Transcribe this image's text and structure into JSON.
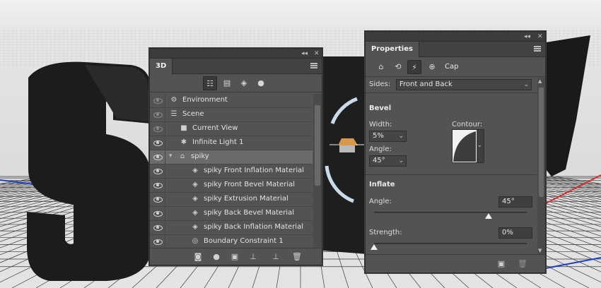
{
  "panel_3d": {
    "tab_label": "3D",
    "collapse_glyph": "◂◂",
    "close_glyph": "✕",
    "filter_icons": [
      "scene-filter-icon",
      "mesh-filter-icon",
      "material-filter-icon",
      "light-filter-icon"
    ],
    "rows": [
      {
        "label": "Environment",
        "icon": "⚙",
        "icon_name": "environment-icon",
        "indent": 1,
        "eye": "dim"
      },
      {
        "label": "Scene",
        "icon": "☰",
        "icon_name": "scene-icon",
        "indent": 1,
        "eye": "dim"
      },
      {
        "label": "Current View",
        "icon": "■",
        "icon_name": "camera-icon",
        "indent": 2,
        "eye": "dim"
      },
      {
        "label": "Infinite Light 1",
        "icon": "✱",
        "icon_name": "light-icon",
        "indent": 2,
        "eye": "on"
      },
      {
        "label": "spiky",
        "icon": "⌂",
        "icon_name": "mesh-icon",
        "indent": 1,
        "eye": "on",
        "selected": true,
        "twist": "▾"
      },
      {
        "label": "spiky Front Inflation Material",
        "icon": "◈",
        "icon_name": "material-icon",
        "indent": 3,
        "eye": "on"
      },
      {
        "label": "spiky Front Bevel Material",
        "icon": "◈",
        "icon_name": "material-icon",
        "indent": 3,
        "eye": "on"
      },
      {
        "label": "spiky Extrusion Material",
        "icon": "◈",
        "icon_name": "material-icon",
        "indent": 3,
        "eye": "on"
      },
      {
        "label": "spiky Back Bevel Material",
        "icon": "◈",
        "icon_name": "material-icon",
        "indent": 3,
        "eye": "on"
      },
      {
        "label": "spiky Back Inflation Material",
        "icon": "◈",
        "icon_name": "material-icon",
        "indent": 3,
        "eye": "on"
      },
      {
        "label": "Boundary Constraint 1",
        "icon": "◎",
        "icon_name": "constraint-icon",
        "indent": 3,
        "eye": "on"
      }
    ],
    "bottom_icons": [
      "light-add-icon",
      "new-light-icon",
      "render-icon",
      "ground-icon",
      "drop-to-plane-icon",
      "trash-icon"
    ]
  },
  "properties": {
    "tab_label": "Properties",
    "collapse_glyph": "◂◂",
    "close_glyph": "✕",
    "mode_label": "Cap",
    "sides_label": "Sides:",
    "sides_value": "Front and Back",
    "bevel": {
      "title": "Bevel",
      "width_label": "Width:",
      "width_value": "5%",
      "angle_label": "Angle:",
      "angle_value": "45°",
      "contour_label": "Contour:"
    },
    "inflate": {
      "title": "Inflate",
      "angle_label": "Angle:",
      "angle_value": "45°",
      "angle_slider_fraction": 0.75,
      "strength_label": "Strength:",
      "strength_value": "0%",
      "strength_slider_fraction": 0.0
    }
  },
  "colors": {
    "panel_bg": "#535353",
    "selected_row": "#6b6b6b",
    "axis_red": "#d03030",
    "axis_blue": "#2040c0"
  }
}
